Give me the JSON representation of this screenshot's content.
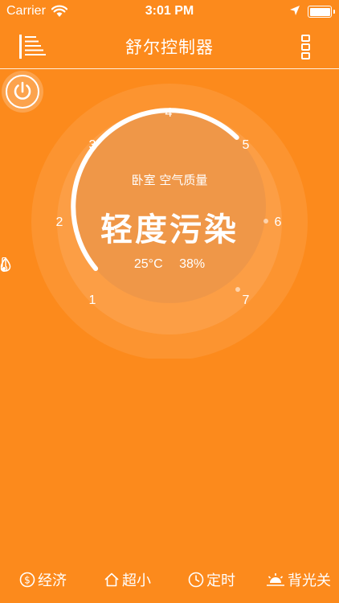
{
  "status_bar": {
    "carrier": "Carrier",
    "time": "3:01 PM"
  },
  "header": {
    "title": "舒尔控制器"
  },
  "dial": {
    "room_label": "卧室 空气质量",
    "quality": "轻度污染",
    "temperature": "25°C",
    "humidity": "38%",
    "scale": [
      "1",
      "2",
      "3",
      "4",
      "5",
      "6",
      "7"
    ],
    "level_fraction": 0.67
  },
  "bottom_bar": {
    "economy": "经济",
    "minimum": "超小",
    "timer": "定时",
    "backlight": "背光关"
  },
  "colors": {
    "background": "#FC8A1C",
    "foreground": "#FFFFFF"
  }
}
